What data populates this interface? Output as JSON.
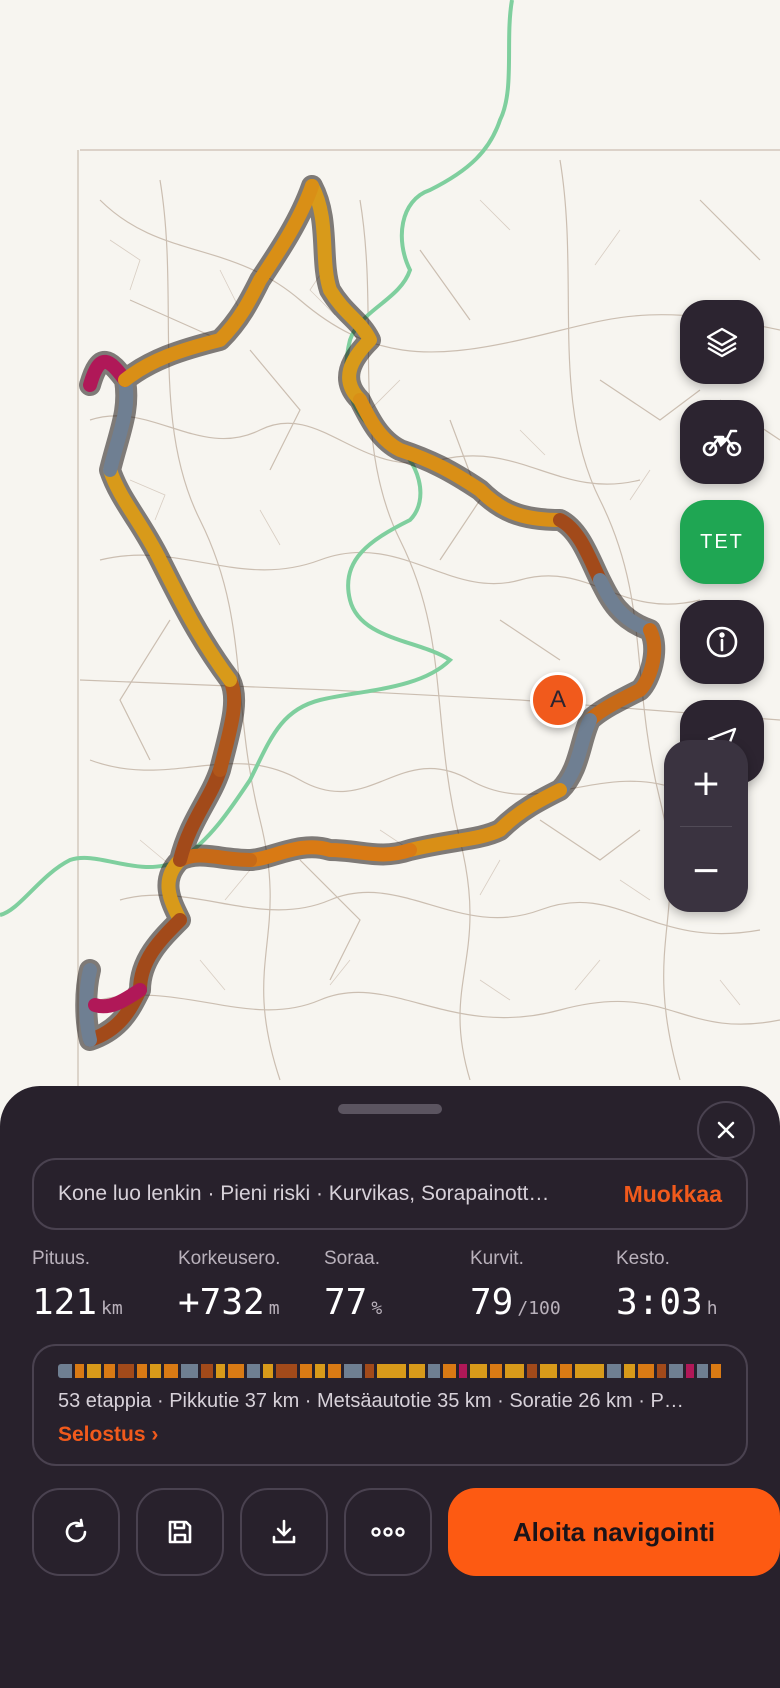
{
  "map": {
    "marker_label": "A",
    "route_colors": {
      "paved": "#d89a1a",
      "forest": "#d97a14",
      "gravel": "#a24a1a",
      "trail": "#6f7f92",
      "risky": "#b01858"
    },
    "boundary_color": "#7fcf9e"
  },
  "controls": {
    "layers_icon": "layers-icon",
    "bike_icon": "motorbike-icon",
    "tet_label": "TET",
    "info_icon": "info-icon",
    "locate_icon": "navigation-arrow-icon",
    "zoom_in": "+",
    "zoom_out": "−"
  },
  "sheet": {
    "close_icon": "close-icon",
    "prompt_text": "Kone luo lenkin · Pieni riski · Kurvikas, Sorapainott…",
    "edit_label": "Muokkaa",
    "stats": [
      {
        "label": "Pituus.",
        "value": "121",
        "unit": "km"
      },
      {
        "label": "Korkeusero.",
        "value": "+732",
        "unit": "m"
      },
      {
        "label": "Soraa.",
        "value": "77",
        "unit": "%"
      },
      {
        "label": "Kurvit.",
        "value": "79",
        "unit": "/100"
      },
      {
        "label": "Kesto.",
        "value": "3:03",
        "unit": "h"
      }
    ],
    "segments_text": "53 etappia · Pikkutie 37 km · Metsäautotie 35 km · Soratie 26 km · P…",
    "segments_link": "Selostus ›",
    "actions": {
      "regenerate_icon": "refresh-icon",
      "save_icon": "save-icon",
      "download_icon": "download-icon",
      "more_icon": "more-icon",
      "navigate_label": "Aloita navigointi"
    }
  }
}
